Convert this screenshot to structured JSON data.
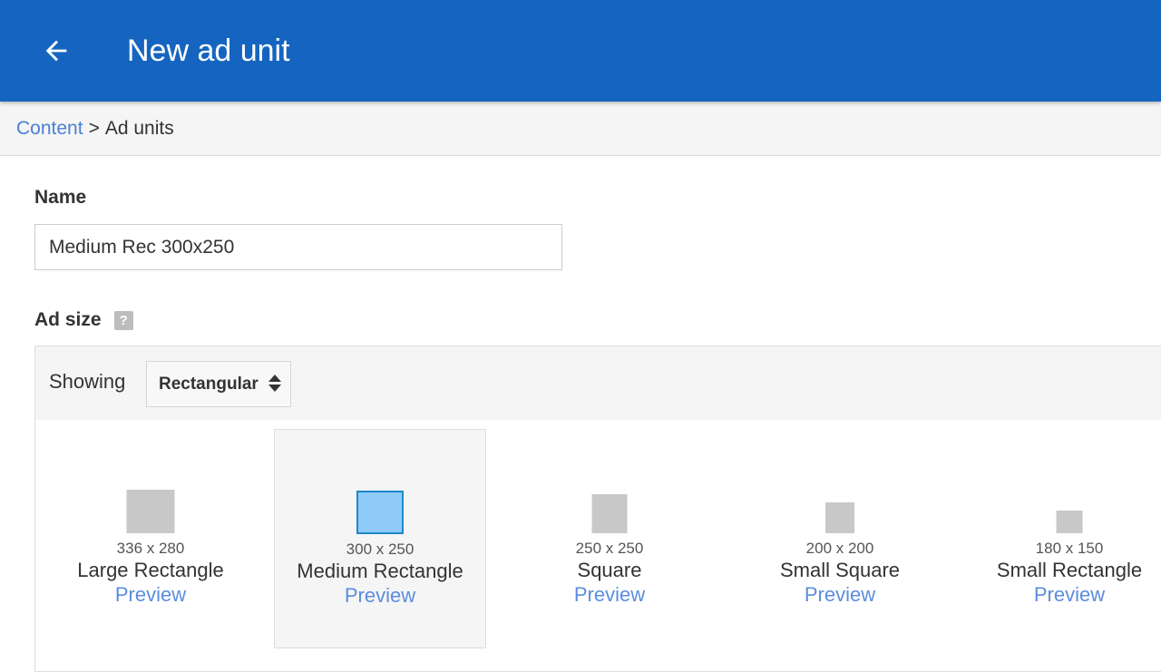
{
  "header": {
    "back_icon": "arrow-back-icon",
    "title": "New ad unit",
    "bg_color": "#1565c0"
  },
  "breadcrumb": {
    "link": "Content",
    "separator": ">",
    "current": "Ad units"
  },
  "form": {
    "name_label": "Name",
    "name_value": "Medium Rec 300x250",
    "ad_size_label": "Ad size",
    "help_icon": "?"
  },
  "ad_size": {
    "showing_label": "Showing",
    "filter_selected": "Rectangular",
    "options": [
      {
        "dims": "336 x 280",
        "name": "Large Rectangle",
        "preview": "Preview",
        "selected": false
      },
      {
        "dims": "300 x 250",
        "name": "Medium Rectangle",
        "preview": "Preview",
        "selected": true
      },
      {
        "dims": "250 x 250",
        "name": "Square",
        "preview": "Preview",
        "selected": false
      },
      {
        "dims": "200 x 200",
        "name": "Small Square",
        "preview": "Preview",
        "selected": false
      },
      {
        "dims": "180 x 150",
        "name": "Small Rectangle",
        "preview": "Preview",
        "selected": false
      }
    ]
  }
}
